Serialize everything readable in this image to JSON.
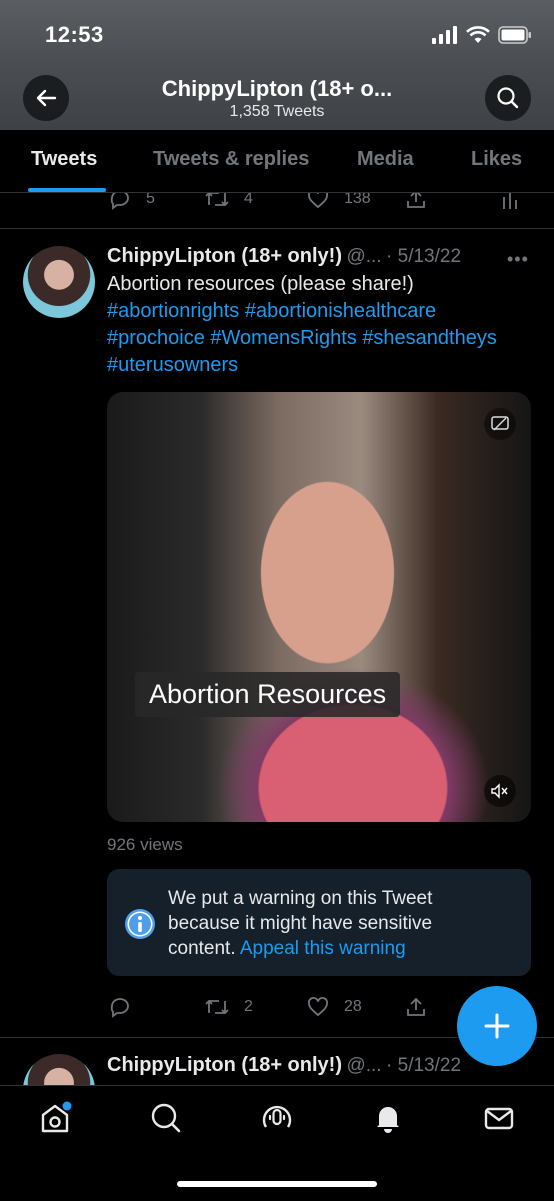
{
  "status_bar": {
    "time": "12:53"
  },
  "header": {
    "title": "ChippyLipton (18+ o...",
    "subtitle": "1,358 Tweets"
  },
  "tabs": [
    {
      "label": "Tweets",
      "active": true
    },
    {
      "label": "Tweets & replies"
    },
    {
      "label": "Media"
    },
    {
      "label": "Likes"
    }
  ],
  "prev_tweet_actions": {
    "replies": "5",
    "retweets": "4",
    "likes": "138"
  },
  "tweet": {
    "display_name": "ChippyLipton (18+ only!)",
    "handle": "@...",
    "date": "· 5/13/22",
    "text": "Abortion resources (please share!)",
    "hashtags_line1": "#abortionrights #abortionishealthcare",
    "hashtags_line2": "#prochoice #WomensRights #shesandtheys",
    "hashtags_line3": "#uterusowners",
    "video_caption": "Abortion Resources",
    "views": "926 views",
    "warning_text": "We put a warning on this Tweet because it might have sensitive content.",
    "warning_link": "Appeal this warning",
    "actions": {
      "replies": "",
      "retweets": "2",
      "likes": "28"
    }
  },
  "next_tweet": {
    "display_name": "ChippyLipton (18+ only!)",
    "handle": "@...",
    "date": "· 5/13/22"
  },
  "colors": {
    "accent": "#1d9bf0",
    "background": "#000000",
    "warning_bg": "#16202b"
  },
  "icons": [
    "back-arrow-icon",
    "search-icon",
    "reply-icon",
    "retweet-icon",
    "like-icon",
    "share-icon",
    "analytics-icon",
    "captions-icon",
    "mute-icon",
    "info-icon",
    "compose-plus-icon",
    "home-icon",
    "explore-icon",
    "spaces-icon",
    "notifications-icon",
    "messages-icon"
  ]
}
